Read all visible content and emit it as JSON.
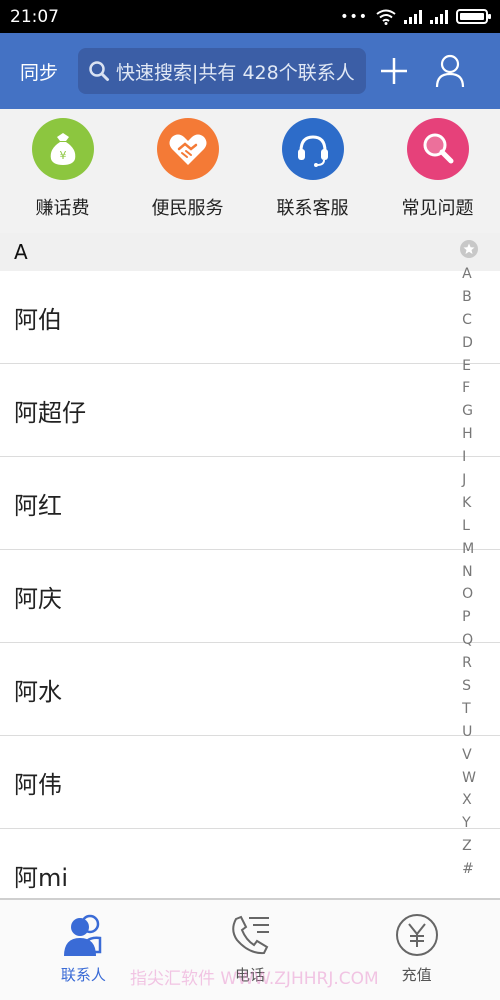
{
  "status_bar": {
    "time": "21:07",
    "dots": "•••"
  },
  "header": {
    "sync_label": "同步",
    "search_placeholder": "快速搜索|共有 428个联系人"
  },
  "services": [
    {
      "label": "赚话费",
      "icon": "money-bag-icon",
      "color": "#8cc63f"
    },
    {
      "label": "便民服务",
      "icon": "handshake-heart-icon",
      "color": "#f47a36"
    },
    {
      "label": "联系客服",
      "icon": "headset-icon",
      "color": "#2d6cc9"
    },
    {
      "label": "常见问题",
      "icon": "magnifier-icon",
      "color": "#e6417a"
    }
  ],
  "contacts": {
    "section": "A",
    "items": [
      "阿伯",
      "阿超仔",
      "阿红",
      "阿庆",
      "阿水",
      "阿伟",
      "阿mi"
    ]
  },
  "index_bar": [
    "A",
    "B",
    "C",
    "D",
    "E",
    "F",
    "G",
    "H",
    "I",
    "J",
    "K",
    "L",
    "M",
    "N",
    "O",
    "P",
    "Q",
    "R",
    "S",
    "T",
    "U",
    "V",
    "W",
    "X",
    "Y",
    "Z",
    "#"
  ],
  "bottom_nav": [
    {
      "label": "联系人",
      "active": true
    },
    {
      "label": "电话",
      "active": false
    },
    {
      "label": "充值",
      "active": false
    }
  ],
  "watermark": "指尖汇软件 WWW.ZJHHRJ.COM",
  "colors": {
    "header": "#4472c4",
    "accent": "#3a6bd6"
  }
}
